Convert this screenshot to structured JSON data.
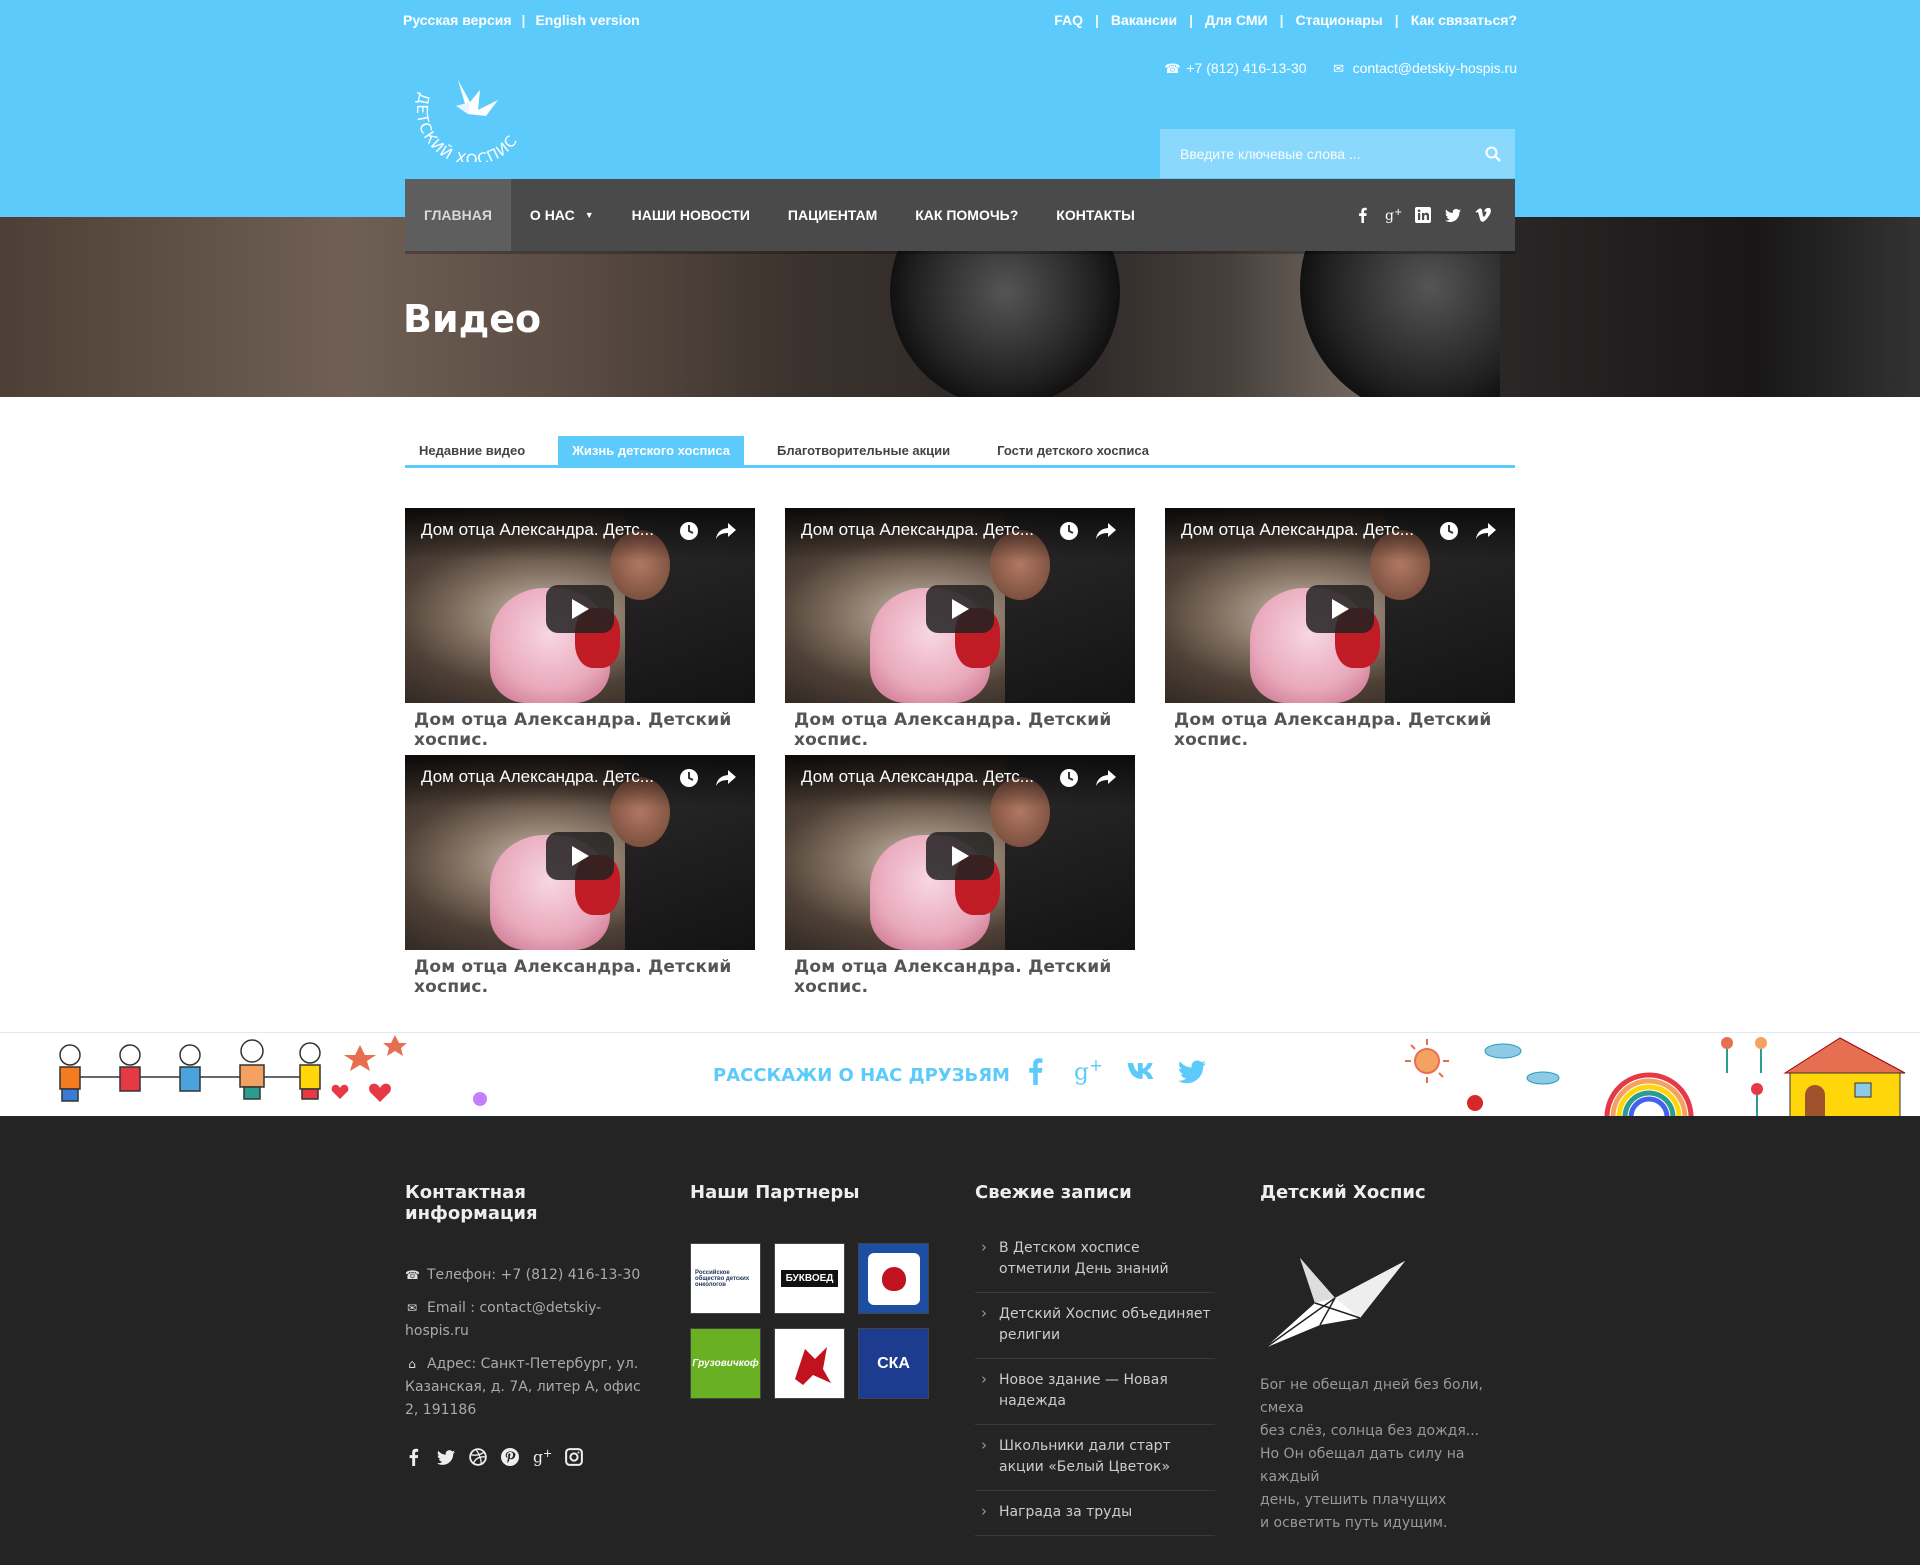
{
  "lang_links": [
    "Русская версия",
    "English version"
  ],
  "util_links": [
    "FAQ",
    "Вакансии",
    "Для СМИ",
    "Стационары",
    "Как связаться?"
  ],
  "contact_phone": "+7 (812) 416-13-30",
  "contact_email": "contact@detskiy-hospis.ru",
  "logo_text": "ДЕТСКИЙ ХОСПИС",
  "search": {
    "placeholder": "Введите ключевые слова ..."
  },
  "nav": {
    "items": [
      "Главная",
      "О нас",
      "Наши новости",
      "Пациентам",
      "Как помочь?",
      "Контакты"
    ],
    "social_icons": [
      "facebook-icon",
      "google-plus-icon",
      "linkedin-icon",
      "twitter-icon",
      "vimeo-icon"
    ]
  },
  "hero": {
    "title": "Видео"
  },
  "tabs": [
    "Недавние видео",
    "Жизнь детского хосписа",
    "Благотворительные акции",
    "Гости детского хосписа"
  ],
  "active_tab": "Жизнь детского хосписа",
  "videos": [
    {
      "overlay_title": "Дом отца Александра. Детс...",
      "caption": "Дом отца Александра. Детский хоспис."
    },
    {
      "overlay_title": "Дом отца Александра. Детс...",
      "caption": "Дом отца Александра. Детский хоспис."
    },
    {
      "overlay_title": "Дом отца Александра. Детс...",
      "caption": "Дом отца Александра. Детский хоспис."
    },
    {
      "overlay_title": "Дом отца Александра. Детс...",
      "caption": "Дом отца Александра. Детский хоспис."
    },
    {
      "overlay_title": "Дом отца Александра. Детс...",
      "caption": "Дом отца Александра. Детский хоспис."
    }
  ],
  "share": {
    "text": "РАССКАЖИ О НАС ДРУЗЬЯМ",
    "icons": [
      "facebook-icon",
      "google-plus-icon",
      "vk-icon",
      "twitter-icon"
    ]
  },
  "footer": {
    "contact": {
      "title": "Контактная информация",
      "phone": "Телефон: +7 (812) 416-13-30",
      "email": "Email : contact@detskiy-hospis.ru",
      "address": "Адрес: Санкт-Петербург, ул. Казанская, д. 7А, литер А, офис 2, 191186",
      "social_icons": [
        "facebook-icon",
        "twitter-icon",
        "dribbble-icon",
        "pinterest-icon",
        "google-plus-icon",
        "instagram-icon"
      ]
    },
    "partners": {
      "title": "Наши Партнеры",
      "logos": [
        {
          "name": "Российское общество детских онкологов",
          "text": "Российское общество детских онкологов"
        },
        {
          "name": "Буквоед",
          "text": "БУКВОЕД"
        },
        {
          "name": "Росгвардия",
          "text": ""
        },
        {
          "name": "Грузовичкоф",
          "text": "Грузовичкоф"
        },
        {
          "name": "Грифон",
          "text": ""
        },
        {
          "name": "СКА",
          "text": "СКА"
        }
      ]
    },
    "recent": {
      "title": "Свежие записи",
      "posts": [
        "В Детском хосписе отметили День знаний",
        "Детский Хоспис объединяет религии",
        "Новое здание — Новая надежда",
        "Школьники дали старт акции «Белый Цветок»",
        "Награда за труды"
      ]
    },
    "about": {
      "title": "Детский Хоспис",
      "quote": [
        "Бог не обещал дней без боли, смеха",
        "без слёз, солнца без дождя...",
        "Но Он обещал дать силу на каждый",
        "день, утешить плачущих",
        "и осветить путь идущим."
      ]
    }
  },
  "colors": {
    "brand_blue": "#5ccbfc",
    "nav_bg": "#4a4a4a",
    "footer_bg": "#242424"
  }
}
